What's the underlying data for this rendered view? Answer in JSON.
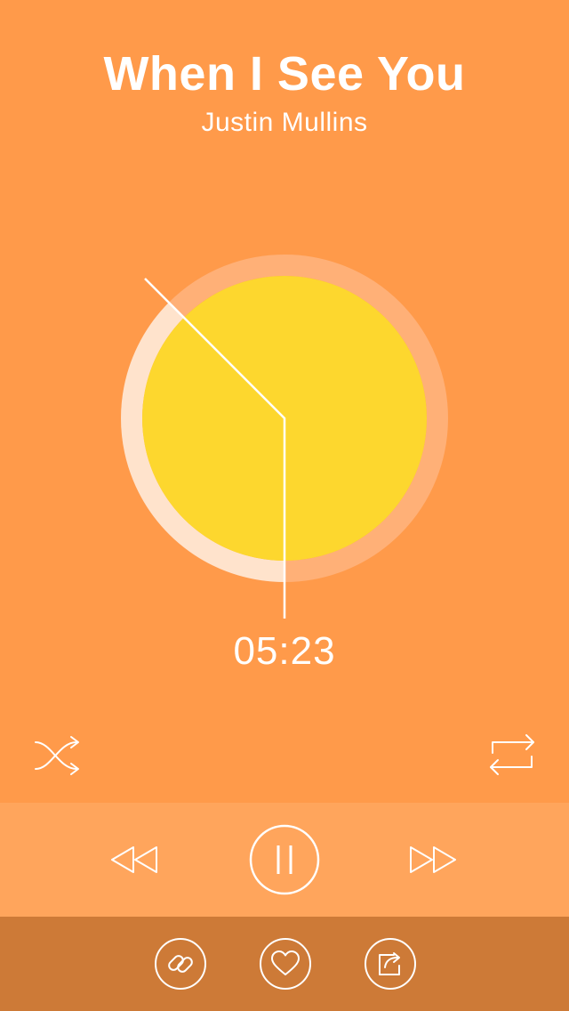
{
  "track": {
    "title": "When I See You",
    "artist": "Justin Mullins",
    "time": "05:23"
  },
  "colors": {
    "background": "#FF9A4A",
    "controls_bar": "#FFA55C",
    "bottom_bar": "#CD7A37",
    "disc": "#FDD72E",
    "ring_progress": "#FFE3CC",
    "ring_track": "#FFB077",
    "text": "#FFFFFF"
  },
  "icons": {
    "shuffle": "shuffle-icon",
    "repeat": "repeat-icon",
    "rewind": "rewind-icon",
    "pause": "pause-icon",
    "fast_forward": "fast-forward-icon",
    "link": "link-icon",
    "like": "heart-icon",
    "share": "share-icon"
  }
}
